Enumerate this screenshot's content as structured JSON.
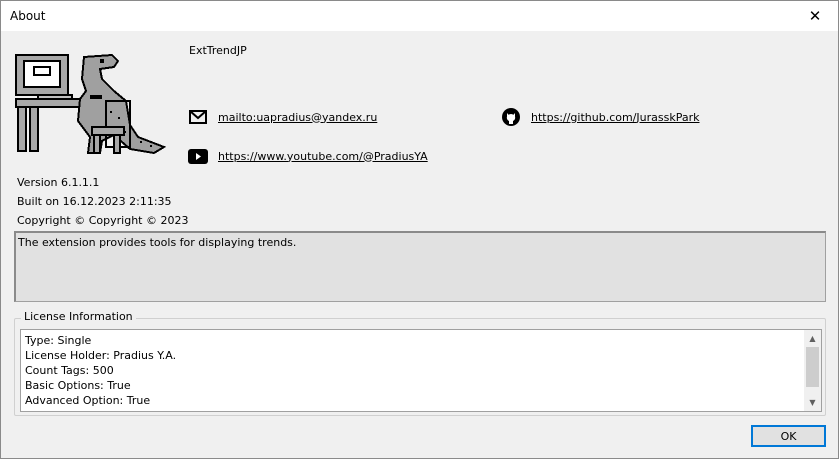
{
  "window": {
    "title": "About",
    "close_glyph": "✕"
  },
  "app": {
    "name": "ExtTrendJP"
  },
  "links": {
    "email": {
      "text": "mailto:uapradius@yandex.ru",
      "icon": "envelope-icon"
    },
    "github": {
      "text": "https://github.com/JurasskPark",
      "icon": "github-icon"
    },
    "youtube": {
      "text": "https://www.youtube.com/@PradiusYA",
      "icon": "youtube-icon"
    }
  },
  "info": {
    "version": "Version 6.1.1.1",
    "built": "Built on 16.12.2023 2:11:35",
    "copyright": "Copyright © Copyright © 2023"
  },
  "description": "The extension provides tools for displaying trends.",
  "license": {
    "legend": "License Information",
    "lines": [
      "Type: Single",
      "License Holder: Pradius Y.A.",
      "Count Tags: 500",
      "Basic Options: True",
      "Advanced Option: True"
    ]
  },
  "buttons": {
    "ok": "OK"
  },
  "colors": {
    "logo_gray": "#a0a0a0",
    "focus_blue": "#0078d7"
  }
}
